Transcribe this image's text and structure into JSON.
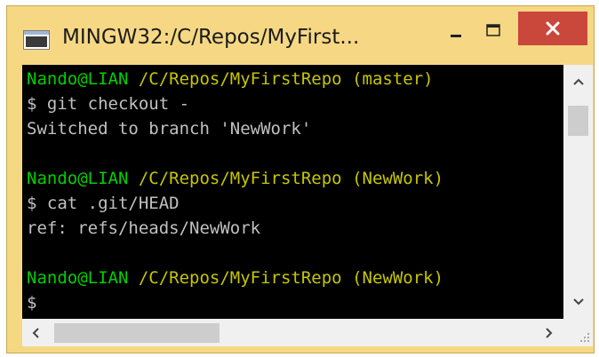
{
  "window": {
    "title": "MINGW32:/C/Repos/MyFirst...",
    "icon": "terminal-window-icon",
    "controls": {
      "minimize_icon": "minimize-icon",
      "maximize_icon": "maximize-icon",
      "close_icon": "close-icon",
      "close_color": "#c9473b"
    },
    "frame_color": "#f6d884"
  },
  "terminal": {
    "background": "#000000",
    "colors": {
      "user": "#00d000",
      "path": "#c6c600",
      "text": "#c0c0c0"
    },
    "lines": [
      {
        "user": "Nando@LIAN",
        "path": "/C/Repos/MyFirstRepo",
        "branch": "(master)"
      },
      {
        "text": "$ git checkout -"
      },
      {
        "text": "Switched to branch 'NewWork'"
      },
      {
        "text": ""
      },
      {
        "user": "Nando@LIAN",
        "path": "/C/Repos/MyFirstRepo",
        "branch": "(NewWork)"
      },
      {
        "text": "$ cat .git/HEAD"
      },
      {
        "text": "ref: refs/heads/NewWork"
      },
      {
        "text": ""
      },
      {
        "user": "Nando@LIAN",
        "path": "/C/Repos/MyFirstRepo",
        "branch": "(NewWork)"
      },
      {
        "text": "$"
      }
    ]
  },
  "scrollbars": {
    "up_icon": "chevron-up-icon",
    "down_icon": "chevron-down-icon",
    "left_icon": "chevron-left-icon",
    "right_icon": "chevron-right-icon",
    "grip_icon": "resize-grip-icon"
  }
}
